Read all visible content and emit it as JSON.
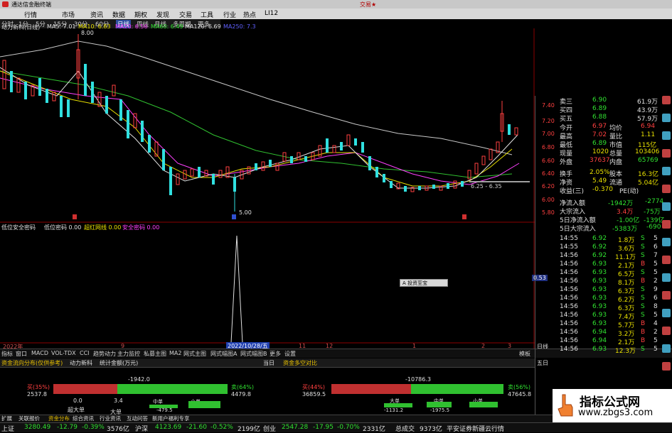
{
  "title_bar": {
    "app_title": "通达信金融终端",
    "right_label": "交易★"
  },
  "menu": [
    "行情",
    "市场",
    "资讯",
    "数据",
    "期权",
    "发现",
    "交易",
    "工具",
    "行业",
    "热点",
    "LI12"
  ],
  "periods": [
    "分时",
    "1分",
    "5分",
    "15分",
    "30分",
    "60分",
    "日线",
    "周线",
    "月线",
    "多周期",
    "更多"
  ],
  "ma_row": {
    "name": "动力新科(日线)",
    "ma5": "MA5: 7.01",
    "ma10": "MA10: 6.83",
    "ma20": "MA20: 6.56",
    "ma60": "MA60: 6.49",
    "ma120": "MA120: 6.69",
    "ma250": "MA250: 7.3"
  },
  "price_axis": [
    "7.40",
    "7.20",
    "7.00",
    "6.80",
    "6.60",
    "6.40",
    "6.20",
    "6.00",
    "5.80"
  ],
  "annotations": {
    "high": "8.00",
    "low": "5.00",
    "last": "6.25 - 6.35"
  },
  "order_book": {
    "sell3": {
      "label": "卖三",
      "price": "6.90",
      "vol": "61.9万"
    },
    "sell4": {
      "label": "买四",
      "price": "6.89",
      "vol": "43.9万"
    },
    "sell5": {
      "label": "买五",
      "price": "6.88",
      "vol": "57.9万"
    }
  },
  "quote": [
    {
      "l": "今开",
      "v": "6.97",
      "l2": "均价",
      "v2": "6.94"
    },
    {
      "l": "最高",
      "v": "7.02",
      "l2": "量比",
      "v2": "1.11"
    },
    {
      "l": "最低",
      "v": "6.89",
      "l2": "市值",
      "v2": "115亿"
    },
    {
      "l": "现量",
      "v": "1020",
      "l2": "总量",
      "v2": "103406"
    },
    {
      "l": "外盘",
      "v": "37637",
      "l2": "内盘",
      "v2": "65769"
    },
    {
      "l": "换手",
      "v": "2.05%",
      "l2": "股本",
      "v2": "16.3亿"
    },
    {
      "l": "净资",
      "v": "5.49",
      "l2": "流通",
      "v2": "5.04亿"
    },
    {
      "l": "收益(三)",
      "v": "-0.370",
      "l2": "PE(动)",
      "v2": ""
    }
  ],
  "flows": [
    {
      "l": "净流入额",
      "v": "-1942万",
      "v2": "-2774"
    },
    {
      "l": "大宗流入",
      "v": "3.4万",
      "v2": "-75万"
    },
    {
      "l": "5日净流入额",
      "v": "-1.00亿",
      "v2": "-139亿"
    },
    {
      "l": "5日大宗流入",
      "v": "-5383万",
      "v2": "-690"
    }
  ],
  "ticks": [
    {
      "t": "14:55",
      "p": "6.92",
      "v": "1.8万",
      "d": "S",
      "n": "5"
    },
    {
      "t": "14:55",
      "p": "6.92",
      "v": "3.6万",
      "d": "S",
      "n": "6"
    },
    {
      "t": "14:56",
      "p": "6.92",
      "v": "11.1万",
      "d": "S",
      "n": "7"
    },
    {
      "t": "14:56",
      "p": "6.93",
      "v": "2.1万",
      "d": "B",
      "n": "5"
    },
    {
      "t": "14:56",
      "p": "6.93",
      "v": "6.5万",
      "d": "S",
      "n": "5"
    },
    {
      "t": "14:56",
      "p": "6.93",
      "v": "8.1万",
      "d": "B",
      "n": "2"
    },
    {
      "t": "14:56",
      "p": "6.93",
      "v": "6.3万",
      "d": "S",
      "n": "9"
    },
    {
      "t": "14:56",
      "p": "6.93",
      "v": "6.2万",
      "d": "S",
      "n": "6"
    },
    {
      "t": "14:56",
      "p": "6.93",
      "v": "6.3万",
      "d": "S",
      "n": "8"
    },
    {
      "t": "14:56",
      "p": "6.93",
      "v": "7.4万",
      "d": "S",
      "n": "5"
    },
    {
      "t": "14:56",
      "p": "6.93",
      "v": "5.7万",
      "d": "B",
      "n": "4"
    },
    {
      "t": "14:56",
      "p": "6.94",
      "v": "3.2万",
      "d": "B",
      "n": "2"
    },
    {
      "t": "14:56",
      "p": "6.94",
      "v": "2.1万",
      "d": "B",
      "n": "5"
    },
    {
      "t": "14:56",
      "p": "6.93",
      "v": "12.3万",
      "d": "S",
      "n": "5"
    }
  ],
  "indicator_row": {
    "name": "低位安全密码",
    "v1": "低位密码  0.00",
    "v2": "超红网线  0.00",
    "v3": "安全密码  0.00"
  },
  "popup_label": "A 投资至宝",
  "right_axis_mark": "0.53",
  "date_axis": [
    "2022年",
    "9",
    "2022/10/28/五",
    "11",
    "12",
    "1",
    "2",
    "3",
    "日线"
  ],
  "bottom_tabs": [
    "指标",
    "窗口",
    "MACD",
    "VOL-TDX",
    "CCI",
    "趋势动力",
    "主力监控",
    "私募主图",
    "MA2",
    "网式主图",
    "网式幅图A",
    "网式幅图B",
    "更多",
    "设置"
  ],
  "bottom_right": "模板",
  "fund_tabs": [
    "资金流向分布(仅供参考)",
    "动力新科",
    "统计金额(万元)"
  ],
  "day_label": "当日",
  "five_day_label": "五日",
  "fund_left": {
    "buy_pct": "买(35%)",
    "buy_val": "2537.8",
    "sell_pct": "卖(64%)",
    "sell_val": "4479.8",
    "net": "-1942.0",
    "l1": "超大单",
    "l2": "大单",
    "l3": "中单",
    "l4": "小单",
    "n1": "0.0",
    "n2": "3.4",
    "n3": "-479.5"
  },
  "fund_right": {
    "title": "资金多空对比",
    "buy_pct": "买(44%)",
    "buy_val": "36859.5",
    "sell_pct": "卖(56%)",
    "sell_val": "47645.8",
    "net": "-10786.3",
    "l1": "大单",
    "l2": "中单",
    "l3": "小单",
    "n1": "-1131.2",
    "n2": "-1975.5"
  },
  "bottom_left_tabs": [
    "扩展",
    "关联报价",
    "资金分布",
    "综合资讯",
    "行业资讯",
    "互动问答",
    "新用户福利专享"
  ],
  "status": [
    {
      "label": "上证",
      "v": "3280.49",
      "c": "-12.79",
      "p": "-0.39%",
      "a": "3576亿"
    },
    {
      "label": "沪深",
      "v": "4123.69",
      "c": "-21.60",
      "p": "-0.52%",
      "a": "2199亿"
    },
    {
      "label": "创业",
      "v": "2547.28",
      "c": "-17.95",
      "p": "-0.70%",
      "a": "2331亿"
    }
  ],
  "status_total": {
    "label": "总成交",
    "v": "9373亿"
  },
  "status_right": "平安证券新疆云行情",
  "watermark": {
    "title": "指标公式网",
    "url": "www.zbgs3.com"
  },
  "colors": {
    "up": "#ff4040",
    "down": "#30e0e0",
    "ma5": "#e0e0e0",
    "ma10": "#e8e000",
    "ma20": "#ff40ff",
    "ma60": "#30e030",
    "ma120": "#d0d0d0"
  }
}
